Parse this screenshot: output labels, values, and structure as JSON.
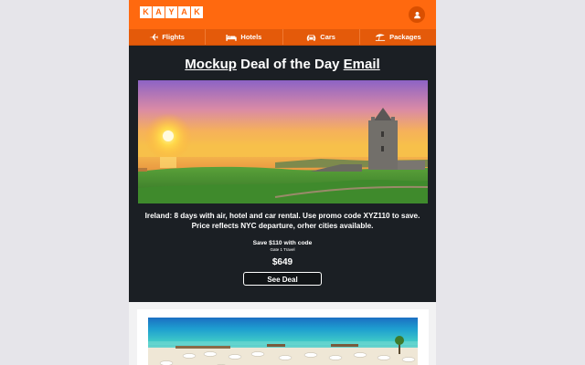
{
  "header": {
    "logo_letters": [
      "K",
      "A",
      "Y",
      "A",
      "K"
    ],
    "account_icon": "user-icon",
    "brand_color": "#ff690f"
  },
  "nav": {
    "items": [
      {
        "label": "Flights",
        "icon": "plane-icon"
      },
      {
        "label": "Hotels",
        "icon": "bed-icon"
      },
      {
        "label": "Cars",
        "icon": "car-icon"
      },
      {
        "label": "Packages",
        "icon": "umbrella-icon"
      }
    ]
  },
  "deal": {
    "title_part1": "Mockup",
    "title_part2": " Deal of the Day ",
    "title_part3": "Email",
    "description": "Ireland: 8 days with air, hotel and car rental. Use promo code XYZ110 to save. Price reflects NYC departure, orher cities available.",
    "save_text": "Save $110 with code",
    "sub_text": "Gate 1 Travel",
    "price": "$649",
    "cta_label": "See Deal"
  }
}
